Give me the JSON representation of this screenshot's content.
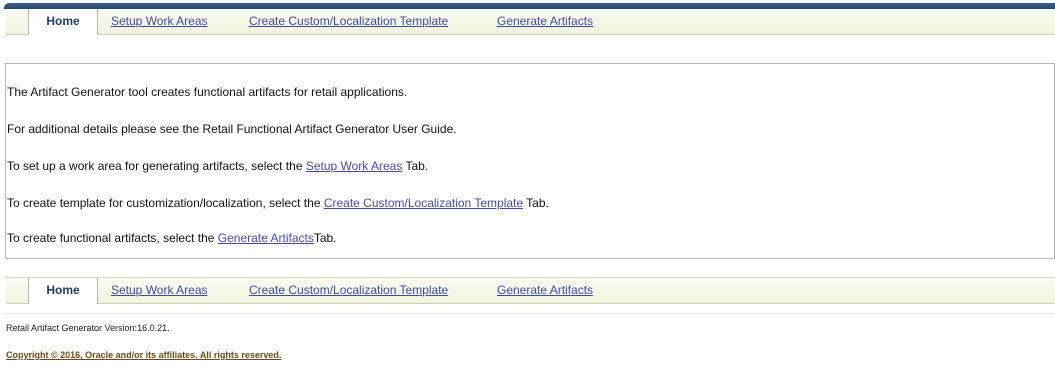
{
  "nav": {
    "tabs": [
      {
        "label": "Home",
        "selected": true
      },
      {
        "label": "Setup Work Areas",
        "selected": false
      },
      {
        "label": "Create Custom/Localization Template",
        "selected": false
      },
      {
        "label": "Generate Artifacts",
        "selected": false
      }
    ]
  },
  "content": {
    "line1": "The Artifact Generator tool creates functional artifacts for retail applications.",
    "line2": "For additional details please see the Retail Functional Artifact Generator User Guide.",
    "line3": {
      "before": "To set up a work area for generating artifacts, select the ",
      "link": "Setup Work Areas",
      "after": " Tab."
    },
    "line4": {
      "before": "To create template for customization/localization, select the ",
      "link": "Create Custom/Localization Template",
      "after": " Tab."
    },
    "line5": {
      "before": "To create functional artifacts, select the ",
      "link": "Generate Artifacts",
      "after": "Tab."
    }
  },
  "footer": {
    "version": "Retail Artifact Generator Version:16.0.21.",
    "copyright": "Copyright © 2016, Oracle and/or its affiliates. All rights reserved."
  },
  "colors": {
    "header_bar": "#2f547a",
    "link": "#4a4aa8",
    "tab_selected_text": "#1d3f62",
    "copyright": "#6a4a1e"
  }
}
